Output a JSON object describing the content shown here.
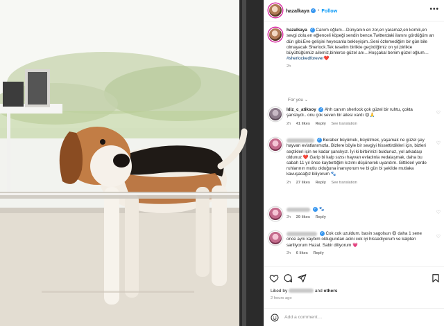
{
  "post": {
    "username": "hazalkaya",
    "follow_label": "Follow",
    "more_label": "•••",
    "caption": "Canım oğlum…Dünyanın en zor,en yaramaz,en komik,en sevgi dolu,en eğlenceli köpeği sendin bence.Twitterdaki ilanını gördüğüm an dün gibi.Eve gelişini heyecanla bekleyişim..Seni özlemediğim bir gün bile olmayacak Sherlock.Tek teselim birlikte geçirdiğimiz on yıl,birlikte büyüttüğümüz ailemiz,binlerce güzel anı…Hoşçakal benim güzel oğlum…",
    "hashtag": "#sherlockedforever",
    "heart": "❤️",
    "time": "2h"
  },
  "section_label": "For you",
  "comments": [
    {
      "username": "ldiz_c_atiksoy",
      "text": "Ahh canım sherlock çok güzel bir ruhtu, çokta şanslıydı.. onu çok seven bir ailesi vardı 😢🙏",
      "time": "2h",
      "likes": "41 likes",
      "reply": "Reply",
      "translate": "See translation"
    },
    {
      "username": "",
      "text": "Beraber büyümek, büyütmek, yaşamak ne güzel şey hayvan evlatlanımızla. Bizlere böyle bir sevgiyi hissettirdikleri için, bizleri seçtikleri için ne kadar şanslıyız. İyi ki birbirinizi buldunuz, yol arkadaşı oldunuz ❤️ Garip bi kalp sızısı hayvan evladınla vedalaşmak, daha bu sabah 11 yıl önce kaybettiğim kızımı düşünerek uyandım. Gittikleri yerde ruhlarının mutlu olduğuna inanıyorum ve bi gün bi şekilde mutlaka kavuşacağız biliyorum 🐾",
      "time": "2h",
      "likes": "27 likes",
      "reply": "Reply",
      "translate": "See translation"
    },
    {
      "username": "",
      "text": "🐾",
      "time": "2h",
      "likes": "29 likes",
      "reply": "Reply",
      "translate": ""
    },
    {
      "username": "",
      "text": "Cok cok uzuldum. basin sagolsun 😩 daha 1 sene once ayni kaybim oldugundan acini cok iyi hissediyorum ve kalpten sariliyorum Hazal. Sabir diliyorum 💗",
      "time": "2h",
      "likes": "6 likes",
      "reply": "Reply",
      "translate": ""
    }
  ],
  "liked_by": {
    "prefix": "Liked by",
    "connector": "and",
    "others": "others"
  },
  "posted_ago": "2 hours ago",
  "add_comment_placeholder": "Add a comment…",
  "icons": [
    "heart-icon",
    "comment-icon",
    "share-icon",
    "save-icon",
    "emoji-icon",
    "more-icon",
    "verified-icon"
  ],
  "colors": {
    "accent": "#0095f6",
    "hashtag": "#00376b",
    "muted": "#8e8e8e",
    "like_red": "#ed4956",
    "verified": "#3897f0"
  }
}
